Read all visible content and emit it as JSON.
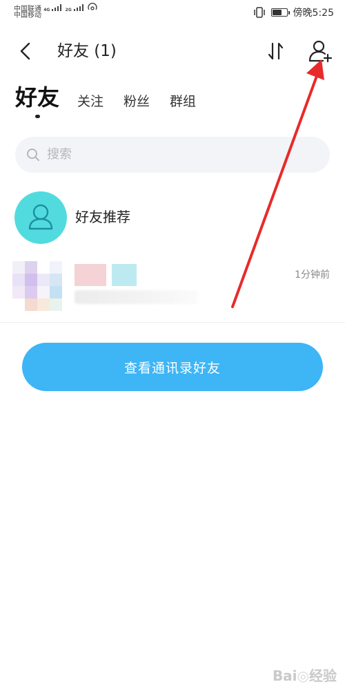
{
  "status_bar": {
    "carrier_1": "中国联通",
    "carrier_1_net": "4G",
    "carrier_2": "中国移动",
    "carrier_2_net": "2G",
    "time": "傍晚5:25",
    "battery_level": 0.7
  },
  "header": {
    "title": "好友 (1)",
    "back_icon": "chevron-left-icon",
    "sort_icon": "sort-arrows-icon",
    "add_friend_icon": "add-person-icon"
  },
  "tabs": [
    {
      "label": "好友",
      "active": true
    },
    {
      "label": "关注",
      "active": false
    },
    {
      "label": "粉丝",
      "active": false
    },
    {
      "label": "群组",
      "active": false
    }
  ],
  "search": {
    "placeholder": "搜索"
  },
  "recommend": {
    "label": "好友推荐",
    "avatar_color": "#52dbde"
  },
  "friends": [
    {
      "time": "1分钟前"
    }
  ],
  "contacts_button": {
    "label": "查看通讯录好友",
    "color": "#3eb5f5"
  },
  "annotation": {
    "arrow_color": "#e82a2a"
  },
  "watermark": {
    "text": "Bai🐾经验"
  }
}
